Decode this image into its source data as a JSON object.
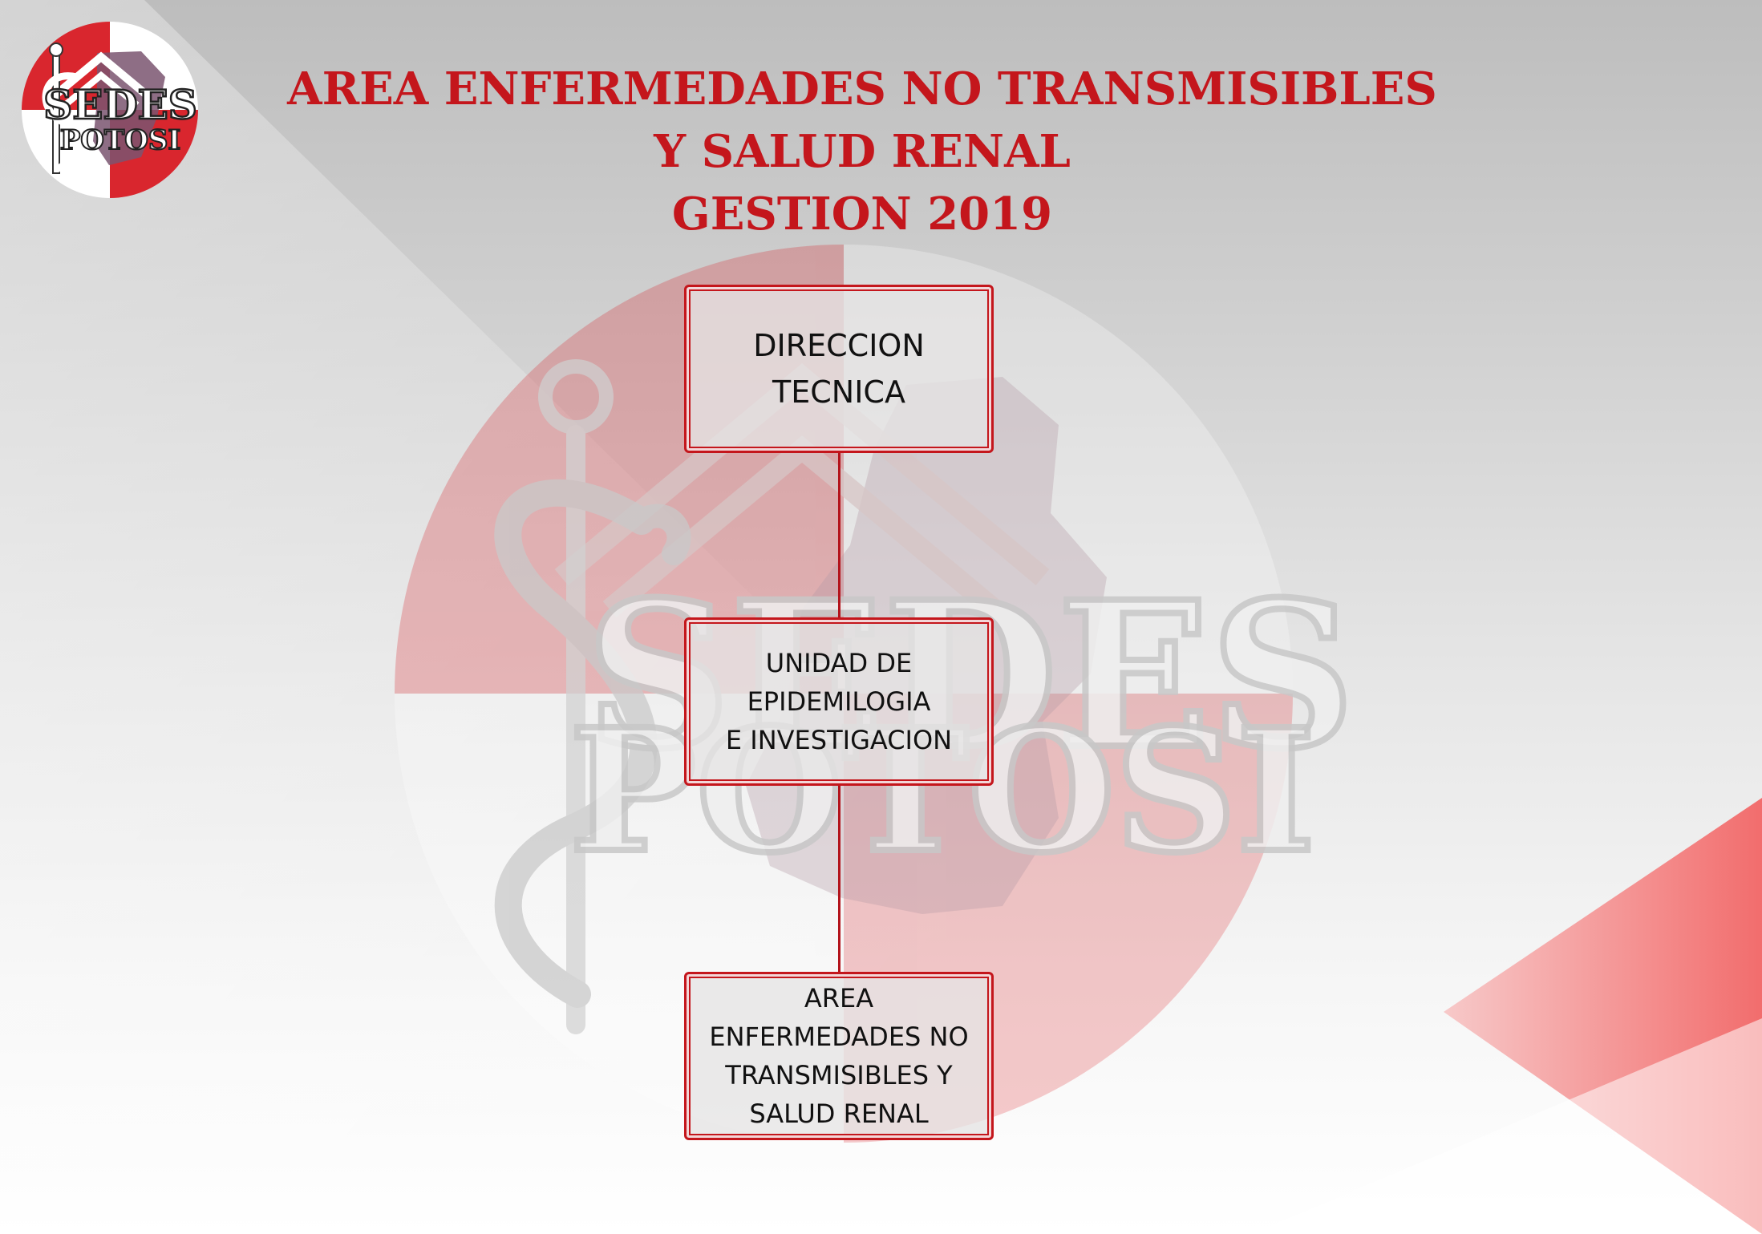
{
  "title": {
    "line1": "AREA ENFERMEDADES NO TRANSMISIBLES",
    "line2": "Y SALUD RENAL",
    "line3": "GESTION 2019"
  },
  "logo": {
    "text_top": "SEDES",
    "text_bottom": "POTOSI",
    "icon": "caduceus-logo-icon"
  },
  "watermark": {
    "text_top": "SEDES",
    "text_bottom": "POTOSI"
  },
  "diagram": {
    "nodes": [
      {
        "id": "direccion-tecnica",
        "label": "DIRECCION\nTECNICA"
      },
      {
        "id": "unidad-epidemiologia",
        "label": "UNIDAD DE\nEPIDEMILOGIA\nE INVESTIGACION"
      },
      {
        "id": "area-ent-salud-renal",
        "label": "AREA\nENFERMEDADES NO\nTRANSMISIBLES Y\nSALUD RENAL"
      }
    ],
    "edges": [
      {
        "from": "direccion-tecnica",
        "to": "unidad-epidemiologia"
      },
      {
        "from": "unidad-epidemiologia",
        "to": "area-ent-salud-renal"
      }
    ]
  },
  "colors": {
    "accent": "#c4161c",
    "box_fill": "#e6e4e4",
    "triangle": "#f26d6d"
  }
}
